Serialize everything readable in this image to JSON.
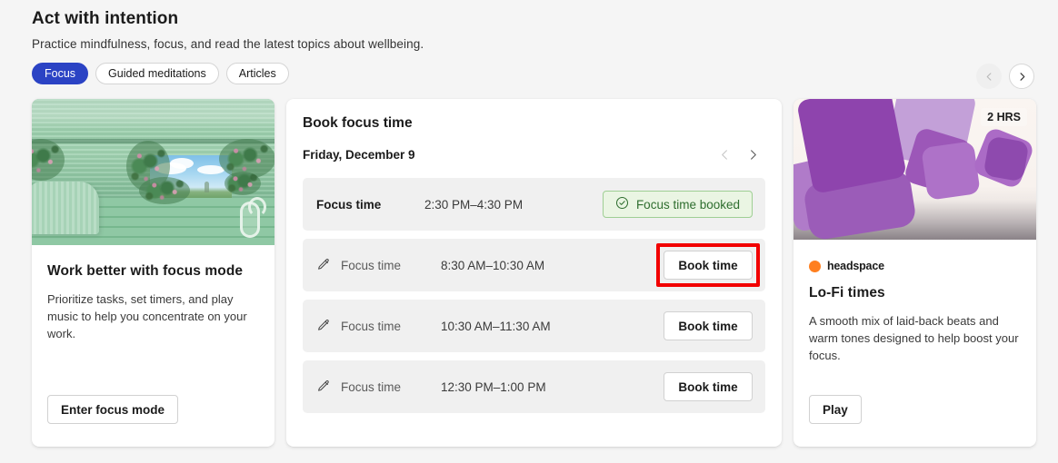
{
  "header": {
    "title": "Act with intention",
    "subtitle": "Practice mindfulness, focus, and read the latest topics about wellbeing.",
    "tabs": [
      {
        "label": "Focus",
        "active": true
      },
      {
        "label": "Guided meditations",
        "active": false
      },
      {
        "label": "Articles",
        "active": false
      }
    ],
    "carousel": {
      "prev_icon": "chevron-left-icon",
      "next_icon": "chevron-right-icon",
      "prev_enabled": false,
      "next_enabled": true
    }
  },
  "colors": {
    "page_background": "#f5f5f5",
    "accent_blue": "#2b43c4",
    "highlight_red": "#f20000",
    "booked_green_text": "#2f6e2f",
    "booked_green_border": "#9fcf94",
    "booked_green_background": "#eaf5e3",
    "brand_orange": "#ff7f1f",
    "card_background": "#ffffff",
    "slot_background": "#f0f0f0"
  },
  "cards": {
    "focus_mode": {
      "image_alt": "green-room-illustration",
      "title": "Work better with focus mode",
      "description": "Prioritize tasks, set timers, and play music to help you concentrate on your work.",
      "button_label": "Enter focus mode"
    },
    "book_focus_time": {
      "title": "Book focus time",
      "date": "Friday, December 9",
      "prev_icon": "chevron-left-icon",
      "next_icon": "chevron-right-icon",
      "slots": [
        {
          "icon": "",
          "label": "Focus time",
          "time": "2:30 PM–4:30 PM",
          "state": "booked",
          "action_label": "Focus time booked",
          "action_icon": "checkmark-circle-icon",
          "highlighted": false
        },
        {
          "icon": "pencil-icon",
          "label": "Focus time",
          "time": "8:30 AM–10:30 AM",
          "state": "available",
          "action_label": "Book time",
          "action_icon": "",
          "highlighted": true
        },
        {
          "icon": "pencil-icon",
          "label": "Focus time",
          "time": "10:30 AM–11:30 AM",
          "state": "available",
          "action_label": "Book time",
          "action_icon": "",
          "highlighted": false
        },
        {
          "icon": "pencil-icon",
          "label": "Focus time",
          "time": "12:30 PM–1:00 PM",
          "state": "available",
          "action_label": "Book time",
          "action_icon": "",
          "highlighted": false
        }
      ]
    },
    "lofi": {
      "image_alt": "purple-squares-illustration",
      "duration_badge": "2 HRS",
      "brand": "headspace",
      "brand_icon": "headspace-orange-dot-icon",
      "title": "Lo-Fi times",
      "description": "A smooth mix of laid-back beats and warm tones designed to help boost your focus.",
      "button_label": "Play"
    }
  }
}
